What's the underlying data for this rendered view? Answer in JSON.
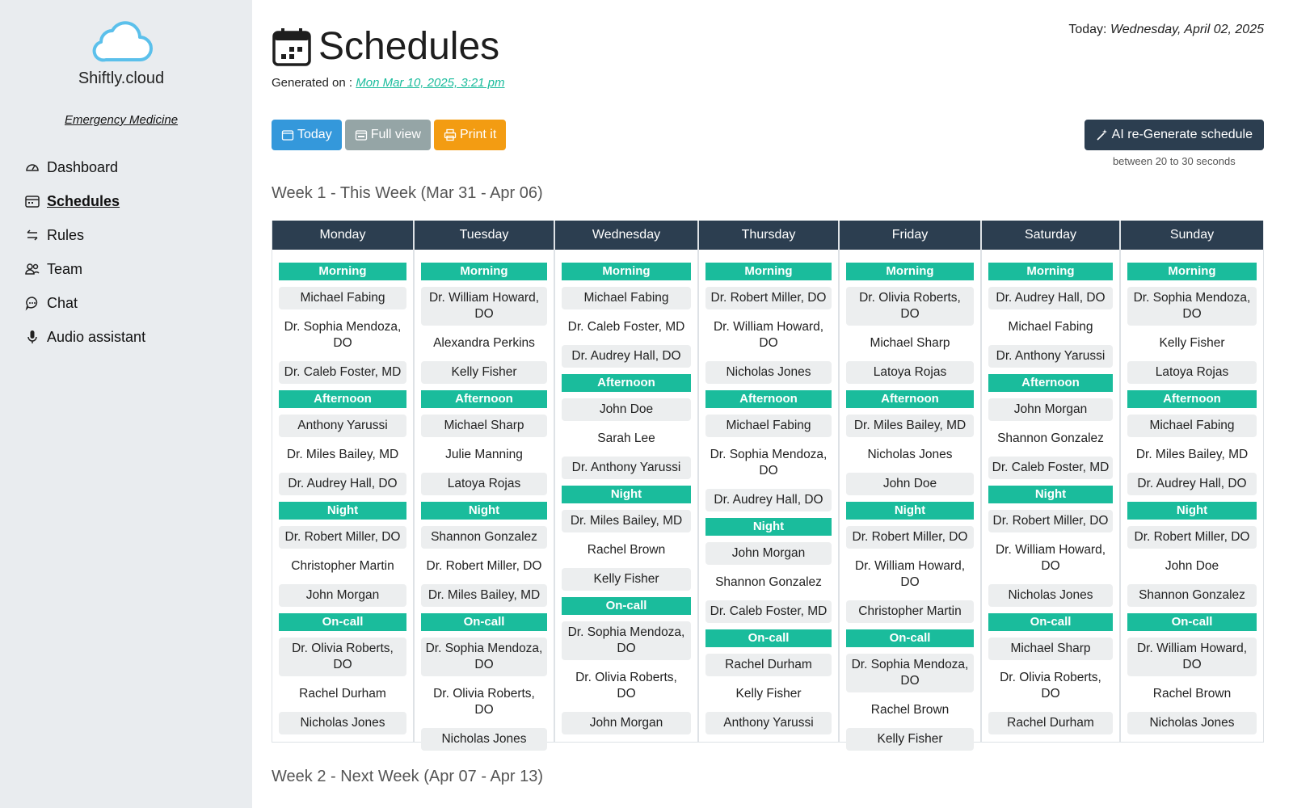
{
  "sidebar": {
    "brand": "Shiftly.cloud",
    "department": "Emergency Medicine",
    "items": [
      {
        "label": "Dashboard",
        "icon": "gauge-icon",
        "active": false
      },
      {
        "label": "Schedules",
        "icon": "calendar-icon",
        "active": true
      },
      {
        "label": "Rules",
        "icon": "arrows-icon",
        "active": false
      },
      {
        "label": "Team",
        "icon": "people-icon",
        "active": false
      },
      {
        "label": "Chat",
        "icon": "chat-icon",
        "active": false
      },
      {
        "label": "Audio assistant",
        "icon": "microphone-icon",
        "active": false
      }
    ]
  },
  "header": {
    "title": "Schedules",
    "today_label": "Today:",
    "today_value": "Wednesday, April 02, 2025",
    "generated_label": "Generated on :",
    "generated_value": "Mon Mar 10, 2025, 3:21 pm"
  },
  "toolbar": {
    "today_btn": "Today",
    "full_view_btn": "Full view",
    "print_btn": "Print it",
    "ai_btn": "AI re-Generate schedule",
    "ai_note": "between 20 to 30 seconds"
  },
  "colors": {
    "accent": "#1abc9c",
    "header": "#2c3e50",
    "blue": "#3498db",
    "gray": "#95a5a6",
    "orange": "#f39c12"
  },
  "weeks": [
    {
      "title": "Week 1 - This Week (Mar 31 - Apr 06)",
      "days": [
        {
          "day": "Monday",
          "shifts": [
            {
              "name": "Morning",
              "people": [
                "Michael Fabing",
                "Dr. Sophia Mendoza, DO",
                "Dr. Caleb Foster, MD"
              ]
            },
            {
              "name": "Afternoon",
              "people": [
                "Anthony Yarussi",
                "Dr. Miles Bailey, MD",
                "Dr. Audrey Hall, DO"
              ]
            },
            {
              "name": "Night",
              "people": [
                "Dr. Robert Miller, DO",
                "Christopher Martin",
                "John Morgan"
              ]
            },
            {
              "name": "On-call",
              "people": [
                "Dr. Olivia Roberts, DO",
                "Rachel Durham",
                "Nicholas Jones"
              ]
            }
          ]
        },
        {
          "day": "Tuesday",
          "shifts": [
            {
              "name": "Morning",
              "people": [
                "Dr. William Howard, DO",
                "Alexandra Perkins",
                "Kelly Fisher"
              ]
            },
            {
              "name": "Afternoon",
              "people": [
                "Michael Sharp",
                "Julie Manning",
                "Latoya Rojas"
              ]
            },
            {
              "name": "Night",
              "people": [
                "Shannon Gonzalez",
                "Dr. Robert Miller, DO",
                "Dr. Miles Bailey, MD"
              ]
            },
            {
              "name": "On-call",
              "people": [
                "Dr. Sophia Mendoza, DO",
                "Dr. Olivia Roberts, DO",
                "Nicholas Jones"
              ]
            }
          ]
        },
        {
          "day": "Wednesday",
          "shifts": [
            {
              "name": "Morning",
              "people": [
                "Michael Fabing",
                "Dr. Caleb Foster, MD",
                "Dr. Audrey Hall, DO"
              ]
            },
            {
              "name": "Afternoon",
              "people": [
                "John Doe",
                "Sarah Lee",
                "Dr. Anthony Yarussi"
              ]
            },
            {
              "name": "Night",
              "people": [
                "Dr. Miles Bailey, MD",
                "Rachel Brown",
                "Kelly Fisher"
              ]
            },
            {
              "name": "On-call",
              "people": [
                "Dr. Sophia Mendoza, DO",
                "Dr. Olivia Roberts, DO",
                "John Morgan"
              ]
            }
          ]
        },
        {
          "day": "Thursday",
          "shifts": [
            {
              "name": "Morning",
              "people": [
                "Dr. Robert Miller, DO",
                "Dr. William Howard, DO",
                "Nicholas Jones"
              ]
            },
            {
              "name": "Afternoon",
              "people": [
                "Michael Fabing",
                "Dr. Sophia Mendoza, DO",
                "Dr. Audrey Hall, DO"
              ]
            },
            {
              "name": "Night",
              "people": [
                "John Morgan",
                "Shannon Gonzalez",
                "Dr. Caleb Foster, MD"
              ]
            },
            {
              "name": "On-call",
              "people": [
                "Rachel Durham",
                "Kelly Fisher",
                "Anthony Yarussi"
              ]
            }
          ]
        },
        {
          "day": "Friday",
          "shifts": [
            {
              "name": "Morning",
              "people": [
                "Dr. Olivia Roberts, DO",
                "Michael Sharp",
                "Latoya Rojas"
              ]
            },
            {
              "name": "Afternoon",
              "people": [
                "Dr. Miles Bailey, MD",
                "Nicholas Jones",
                "John Doe"
              ]
            },
            {
              "name": "Night",
              "people": [
                "Dr. Robert Miller, DO",
                "Dr. William Howard, DO",
                "Christopher Martin"
              ]
            },
            {
              "name": "On-call",
              "people": [
                "Dr. Sophia Mendoza, DO",
                "Rachel Brown",
                "Kelly Fisher"
              ]
            }
          ]
        },
        {
          "day": "Saturday",
          "shifts": [
            {
              "name": "Morning",
              "people": [
                "Dr. Audrey Hall, DO",
                "Michael Fabing",
                "Dr. Anthony Yarussi"
              ]
            },
            {
              "name": "Afternoon",
              "people": [
                "John Morgan",
                "Shannon Gonzalez",
                "Dr. Caleb Foster, MD"
              ]
            },
            {
              "name": "Night",
              "people": [
                "Dr. Robert Miller, DO",
                "Dr. William Howard, DO",
                "Nicholas Jones"
              ]
            },
            {
              "name": "On-call",
              "people": [
                "Michael Sharp",
                "Dr. Olivia Roberts, DO",
                "Rachel Durham"
              ]
            }
          ]
        },
        {
          "day": "Sunday",
          "shifts": [
            {
              "name": "Morning",
              "people": [
                "Dr. Sophia Mendoza, DO",
                "Kelly Fisher",
                "Latoya Rojas"
              ]
            },
            {
              "name": "Afternoon",
              "people": [
                "Michael Fabing",
                "Dr. Miles Bailey, MD",
                "Dr. Audrey Hall, DO"
              ]
            },
            {
              "name": "Night",
              "people": [
                "Dr. Robert Miller, DO",
                "John Doe",
                "Shannon Gonzalez"
              ]
            },
            {
              "name": "On-call",
              "people": [
                "Dr. William Howard, DO",
                "Rachel Brown",
                "Nicholas Jones"
              ]
            }
          ]
        }
      ]
    },
    {
      "title": "Week 2 - Next Week (Apr 07 - Apr 13)"
    }
  ]
}
